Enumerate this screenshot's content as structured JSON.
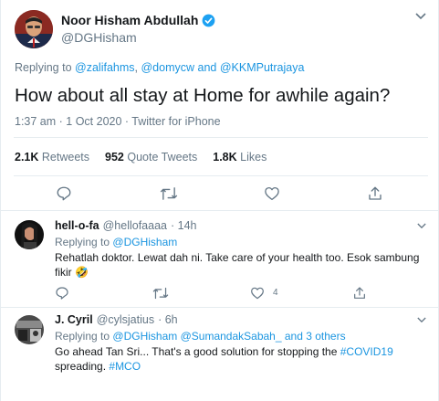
{
  "main_tweet": {
    "author_name": "Noor Hisham Abdullah",
    "handle": "@DGHisham",
    "replying_prefix": "Replying to",
    "replying_to": [
      "@zalifahms",
      "@domycw"
    ],
    "replying_and": "and",
    "replying_last": "@KKMPutrajaya",
    "text": "How about all stay at Home for awhile again?",
    "timestamp": "1:37 am · 1 Oct 2020 · Twitter for iPhone",
    "stats": {
      "retweets_count": "2.1K",
      "retweets_label": "Retweets",
      "quotes_count": "952",
      "quotes_label": "Quote Tweets",
      "likes_count": "1.8K",
      "likes_label": "Likes"
    }
  },
  "replies": [
    {
      "author_name": "hell-o-fa",
      "handle": "@hellofaaaa",
      "time": "· 14h",
      "replying_prefix": "Replying to",
      "replying_to": "@DGHisham",
      "text_line1": "Rehatlah doktor. Lewat dah ni. Take care of your health too. Esok sambung",
      "text_line2": "fikir",
      "emoji": "🤣",
      "like_count": "4"
    },
    {
      "author_name": "J. Cyril",
      "handle": "@cylsjatius",
      "time": "· 6h",
      "replying_prefix": "Replying to",
      "replying_to_1": "@DGHisham",
      "replying_to_2": "@SumandakSabah_",
      "replying_and": "and 3 others",
      "text_line1": "Go ahead Tan Sri... That's a good solution for stopping the",
      "hashtag1": "#COVID19",
      "text_line2": "spreading.",
      "hashtag2": "#MCO"
    }
  ],
  "colors": {
    "link": "#1b95e0",
    "muted": "#657786",
    "verified": "#1da1f2",
    "text": "#14171a"
  },
  "icons": [
    "verified-badge-icon",
    "chevron-down-icon",
    "reply-icon",
    "retweet-icon",
    "like-icon",
    "share-icon"
  ]
}
